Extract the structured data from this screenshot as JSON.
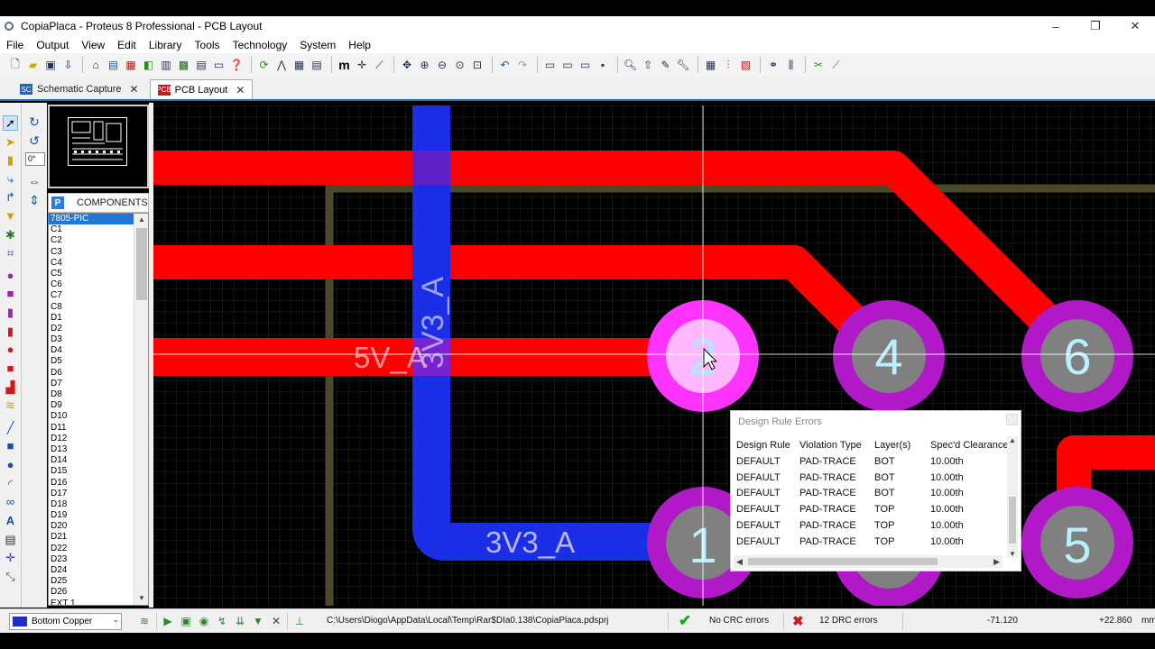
{
  "window": {
    "title": "CopiaPlaca - Proteus 8 Professional - PCB Layout",
    "controls": [
      "–",
      "❐",
      "✕"
    ]
  },
  "menu": [
    "File",
    "Output",
    "View",
    "Edit",
    "Library",
    "Tools",
    "Technology",
    "System",
    "Help"
  ],
  "tabs": [
    {
      "label": "Schematic Capture",
      "icon": "schematic-icon",
      "active": false,
      "close": "✕"
    },
    {
      "label": "PCB Layout",
      "icon": "pcb-icon",
      "active": true,
      "close": "✕"
    }
  ],
  "rotation": {
    "value": "0°"
  },
  "components_panel": {
    "p_button": "P",
    "title": "COMPONENTS",
    "items": [
      "7805-PIC",
      "C1",
      "C2",
      "C3",
      "C4",
      "C5",
      "C6",
      "C7",
      "C8",
      "D1",
      "D2",
      "D3",
      "D4",
      "D5",
      "D6",
      "D7",
      "D8",
      "D9",
      "D10",
      "D11",
      "D12",
      "D13",
      "D14",
      "D15",
      "D16",
      "D17",
      "D18",
      "D19",
      "D20",
      "D21",
      "D22",
      "D23",
      "D24",
      "D25",
      "D26",
      "EXT 1"
    ],
    "selected_index": 0
  },
  "canvas": {
    "labels": {
      "net_5v": "5V_A",
      "net_3v3_vertical": "3V3_A",
      "net_3v3_bottom": "3V3_A"
    },
    "pads": [
      "2",
      "4",
      "6",
      "1",
      "5"
    ],
    "colors": {
      "top_copper": "#ff0000",
      "bottom_copper": "#1a2ee6",
      "pad": "#b018c8",
      "pad_selected": "#ff33ff",
      "pad_hole": "#808080",
      "board_edge": "#4a4a2a"
    }
  },
  "drc_popup": {
    "title": "Design Rule Errors",
    "columns": [
      "Design Rule",
      "Violation Type",
      "Layer(s)",
      "Spec'd Clearance"
    ],
    "rows": [
      [
        "DEFAULT",
        "PAD-TRACE",
        "BOT",
        "10.00th"
      ],
      [
        "DEFAULT",
        "PAD-TRACE",
        "BOT",
        "10.00th"
      ],
      [
        "DEFAULT",
        "PAD-TRACE",
        "BOT",
        "10.00th"
      ],
      [
        "DEFAULT",
        "PAD-TRACE",
        "TOP",
        "10.00th"
      ],
      [
        "DEFAULT",
        "PAD-TRACE",
        "TOP",
        "10.00th"
      ],
      [
        "DEFAULT",
        "PAD-TRACE",
        "TOP",
        "10.00th"
      ]
    ]
  },
  "status": {
    "layer": "Bottom Copper",
    "path": "C:\\Users\\Diogo\\AppData\\Local\\Temp\\Rar$DIa0.138\\CopiaPlaca.pdsprj",
    "crc": "No CRC errors",
    "drc": "12 DRC errors",
    "x": "-71.120",
    "y": "+22.860",
    "unit": "mm"
  }
}
